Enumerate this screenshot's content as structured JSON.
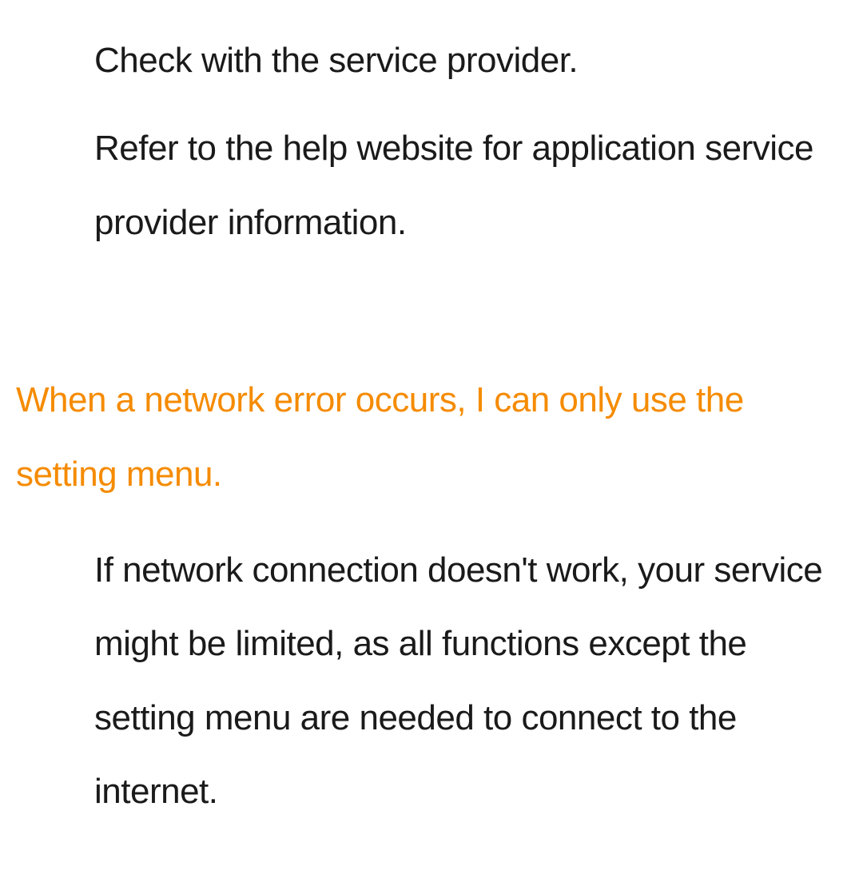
{
  "section1": {
    "line1": "Check with the service provider.",
    "line2": "Refer to the help website for application service provider information."
  },
  "faq": {
    "heading": "When a network error occurs, I can only use the setting menu.",
    "body": "If network connection doesn't work, your service might be limited, as all functions except the setting menu are needed to connect to the internet."
  }
}
